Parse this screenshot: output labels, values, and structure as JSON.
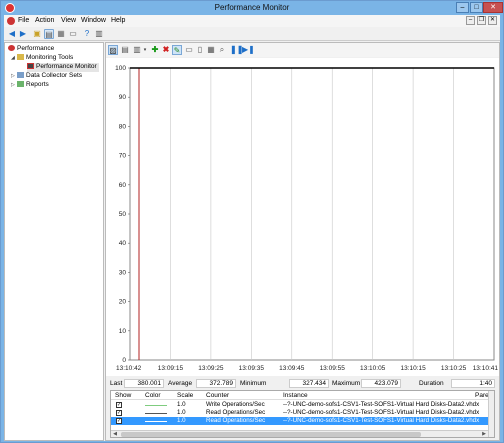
{
  "window": {
    "title": "Performance Monitor"
  },
  "menu": [
    "File",
    "Action",
    "View",
    "Window",
    "Help"
  ],
  "tree": {
    "items": [
      {
        "label": "Performance",
        "level": 0
      },
      {
        "label": "Monitoring Tools",
        "level": 1
      },
      {
        "label": "Performance Monitor",
        "level": 2
      },
      {
        "label": "Data Collector Sets",
        "level": 1
      },
      {
        "label": "Reports",
        "level": 1
      }
    ]
  },
  "stats": {
    "last_label": "Last",
    "last_value": "380.001",
    "average_label": "Average",
    "average_value": "372.789",
    "minimum_label": "Minimum",
    "minimum_value": "327.434",
    "maximum_label": "Maximum",
    "maximum_value": "423.079",
    "duration_label": "Duration",
    "duration_value": "1:40"
  },
  "counters": {
    "headers": [
      "Show",
      "Color",
      "Scale",
      "Counter",
      "Instance",
      "Pare"
    ],
    "rows": [
      {
        "show": true,
        "color": "#7fcc7f",
        "scale": "1.0",
        "counter": "Write Operations/Sec",
        "instance": "--?-UNC-demo-sofs1-CSV1-Test-SOFS1-Virtual Hard Disks-Data2.vhdx",
        "selected": false
      },
      {
        "show": true,
        "color": "#555555",
        "scale": "1.0",
        "counter": "Read Operations/Sec",
        "instance": "--?-UNC-demo-sofs1-CSV1-Test-SOFS1-Virtual Hard Disks-Data2.vhdx",
        "selected": false
      },
      {
        "show": true,
        "color": "#3399ff",
        "scale": "1.0",
        "counter": "Read Operations/Sec",
        "instance": "--?-UNC-demo-sofs1-CSV1-Test-SOFS1-Virtual Hard Disks-Data2.vhdx",
        "selected": true
      }
    ]
  },
  "chart_data": {
    "type": "line",
    "title": "",
    "xlabel": "",
    "ylabel": "",
    "ylim": [
      0,
      100
    ],
    "yticks": [
      0,
      10,
      20,
      30,
      40,
      50,
      60,
      70,
      80,
      90,
      100
    ],
    "xticks": [
      "13:10:42",
      "13:09:15",
      "13:09:25",
      "13:09:35",
      "13:09:45",
      "13:09:55",
      "13:10:05",
      "13:10:15",
      "13:10:25",
      "13:10:41"
    ],
    "grid": "vertical",
    "series": [
      {
        "color": "#000000",
        "values": [
          100,
          100,
          100,
          100,
          100,
          100,
          100,
          100,
          100,
          100
        ]
      }
    ],
    "marker_line_color": "#b22222"
  }
}
